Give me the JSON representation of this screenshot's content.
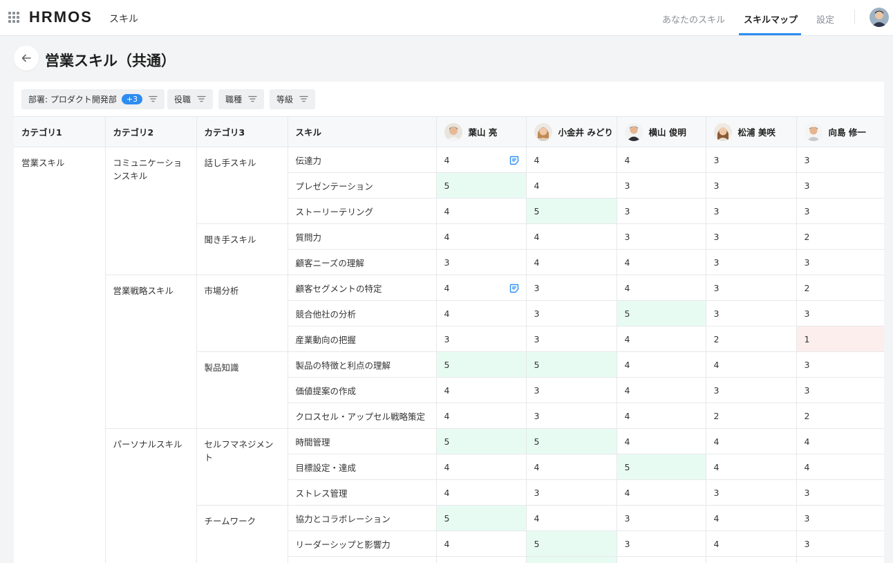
{
  "header": {
    "logo": "HRMOS",
    "product": "スキル",
    "tabs": [
      {
        "label": "あなたのスキル",
        "active": false
      },
      {
        "label": "スキルマップ",
        "active": true
      },
      {
        "label": "設定",
        "active": false
      }
    ]
  },
  "page": {
    "title": "営業スキル（共通）"
  },
  "filters": [
    {
      "label": "部署: プロダクト開発部",
      "count": "+3"
    },
    {
      "label": "役職"
    },
    {
      "label": "職種"
    },
    {
      "label": "等級"
    }
  ],
  "table": {
    "headers": [
      "カテゴリ1",
      "カテゴリ2",
      "カテゴリ3",
      "スキル"
    ],
    "members": [
      "葉山 亮",
      "小金井 みどり",
      "横山 俊明",
      "松浦 美咲",
      "向島 修一"
    ],
    "categories": {
      "cat1": [
        "営業スキル"
      ],
      "cat2": [
        "コミュニケーションスキル",
        "営業戦略スキル",
        "パーソナルスキル"
      ],
      "cat3": [
        "話し手スキル",
        "聞き手スキル",
        "市場分析",
        "製品知識",
        "セルフマネジメント",
        "チームワーク"
      ]
    },
    "rows": [
      {
        "skill": "伝達力",
        "scores": [
          "4",
          "4",
          "4",
          "3",
          "3"
        ]
      },
      {
        "skill": "プレゼンテーション",
        "scores": [
          "5",
          "4",
          "3",
          "3",
          "3"
        ]
      },
      {
        "skill": "ストーリーテリング",
        "scores": [
          "4",
          "5",
          "3",
          "3",
          "3"
        ]
      },
      {
        "skill": "質問力",
        "scores": [
          "4",
          "4",
          "3",
          "3",
          "2"
        ]
      },
      {
        "skill": "顧客ニーズの理解",
        "scores": [
          "3",
          "4",
          "4",
          "3",
          "3"
        ]
      },
      {
        "skill": "顧客セグメントの特定",
        "scores": [
          "4",
          "3",
          "4",
          "3",
          "2"
        ]
      },
      {
        "skill": "競合他社の分析",
        "scores": [
          "4",
          "3",
          "5",
          "3",
          "3"
        ]
      },
      {
        "skill": "産業動向の把握",
        "scores": [
          "3",
          "3",
          "4",
          "2",
          "1"
        ]
      },
      {
        "skill": "製品の特徴と利点の理解",
        "scores": [
          "5",
          "5",
          "4",
          "4",
          "3"
        ]
      },
      {
        "skill": "価値提案の作成",
        "scores": [
          "4",
          "3",
          "4",
          "3",
          "3"
        ]
      },
      {
        "skill": "クロスセル・アップセル戦略策定",
        "scores": [
          "4",
          "3",
          "4",
          "2",
          "2"
        ]
      },
      {
        "skill": "時間管理",
        "scores": [
          "5",
          "5",
          "4",
          "4",
          "4"
        ]
      },
      {
        "skill": "目標設定・達成",
        "scores": [
          "4",
          "4",
          "5",
          "4",
          "4"
        ]
      },
      {
        "skill": "ストレス管理",
        "scores": [
          "4",
          "3",
          "4",
          "3",
          "3"
        ]
      },
      {
        "skill": "協力とコラボレーション",
        "scores": [
          "5",
          "4",
          "3",
          "4",
          "3"
        ]
      },
      {
        "skill": "リーダーシップと影響力",
        "scores": [
          "4",
          "5",
          "3",
          "4",
          "3"
        ]
      },
      {
        "skill": "",
        "scores": [
          "",
          "",
          "",
          "",
          ""
        ]
      }
    ]
  },
  "colors": {
    "accent": "#2d8cf0",
    "high_score_bg": "#e8fbf3",
    "low_score_bg": "#fdeeee"
  }
}
